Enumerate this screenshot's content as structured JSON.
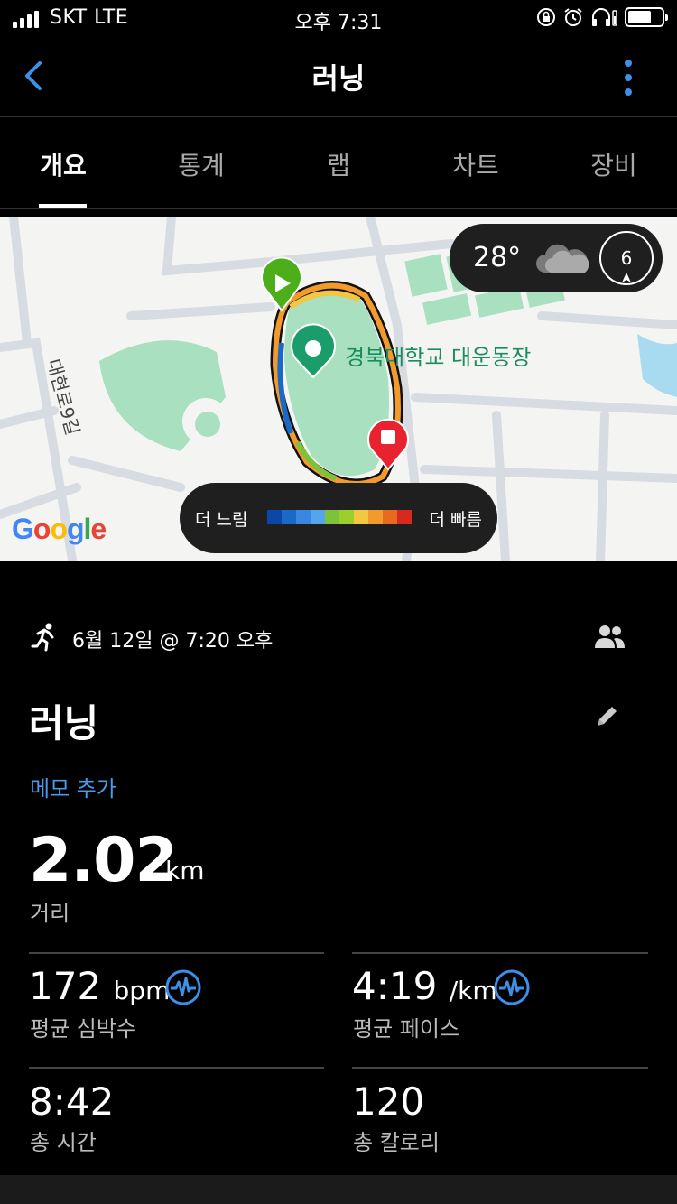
{
  "status_bar": {
    "carrier": "SKT  LTE",
    "time": "오후 7:31"
  },
  "nav": {
    "title": "러닝"
  },
  "tabs": [
    {
      "label": "개요",
      "active": true
    },
    {
      "label": "통계",
      "active": false
    },
    {
      "label": "랩",
      "active": false
    },
    {
      "label": "차트",
      "active": false
    },
    {
      "label": "장비",
      "active": false
    }
  ],
  "map": {
    "place_label": "경북대학교 대운동장",
    "street_label": "대현로9길",
    "weather_temp": "28°",
    "wind_speed": "6",
    "legend_slow": "더 느림",
    "legend_fast": "더 빠름",
    "legend_colors": [
      "#0a47a9",
      "#1a68c8",
      "#3b86e0",
      "#55a5ee",
      "#7cc23a",
      "#9ccf2c",
      "#f2c744",
      "#f39a2c",
      "#e86a1f",
      "#d6291f"
    ],
    "google_logo": "Google"
  },
  "activity": {
    "date": "6월 12일 @ 7:20 오후",
    "title": "러닝",
    "memo_link": "메모 추가",
    "distance_value": "2.02",
    "distance_unit": "km",
    "distance_label": "거리"
  },
  "stats": {
    "heart_rate_value": "172",
    "heart_rate_unit": "bpm",
    "heart_rate_label": "평균 심박수",
    "pace_value": "4:19",
    "pace_unit": "/km",
    "pace_label": "평균 페이스",
    "time_value": "8:42",
    "time_label": "총 시간",
    "calories_value": "120",
    "calories_label": "총 칼로리"
  },
  "colors": {
    "accent": "#3d8fe8",
    "route_start": "#4caf1a",
    "route_end": "#e8222e"
  }
}
